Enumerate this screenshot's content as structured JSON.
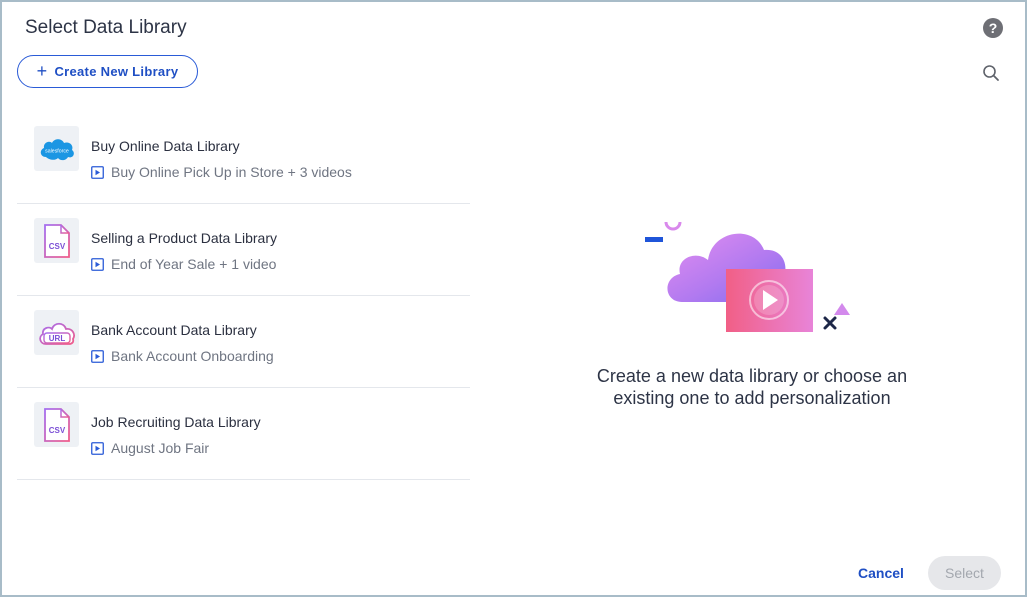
{
  "dialog": {
    "title": "Select Data Library",
    "create_button_label": "Create New Library",
    "cancel_label": "Cancel",
    "select_label": "Select"
  },
  "libraries": [
    {
      "name": "Buy Online Data Library",
      "subtitle": "Buy Online Pick Up in Store + 3 videos",
      "icon": "salesforce-icon",
      "badge": "salesforce"
    },
    {
      "name": "Selling a Product Data Library",
      "subtitle": "End of Year Sale + 1 video",
      "icon": "csv-file-icon",
      "badge": "CSV"
    },
    {
      "name": "Bank Account Data Library",
      "subtitle": "Bank Account Onboarding",
      "icon": "url-cloud-icon",
      "badge": "URL"
    },
    {
      "name": "Job Recruiting Data Library",
      "subtitle": "August Job Fair",
      "icon": "csv-file-icon",
      "badge": "CSV"
    }
  ],
  "empty_state": {
    "line1": "Create a new data library or choose an",
    "line2": "existing one to add personalization"
  },
  "colors": {
    "accent": "#1f4fc4",
    "border": "#a8bcc8",
    "divider": "#e4e7ec",
    "salesforce": "#1b96e3",
    "gradient_pink": "#f05d8a",
    "gradient_purple": "#a46ef0",
    "disabled_bg": "#e6e7ea"
  },
  "icons": [
    "help-icon",
    "plus-icon",
    "search-icon",
    "video-icon"
  ]
}
